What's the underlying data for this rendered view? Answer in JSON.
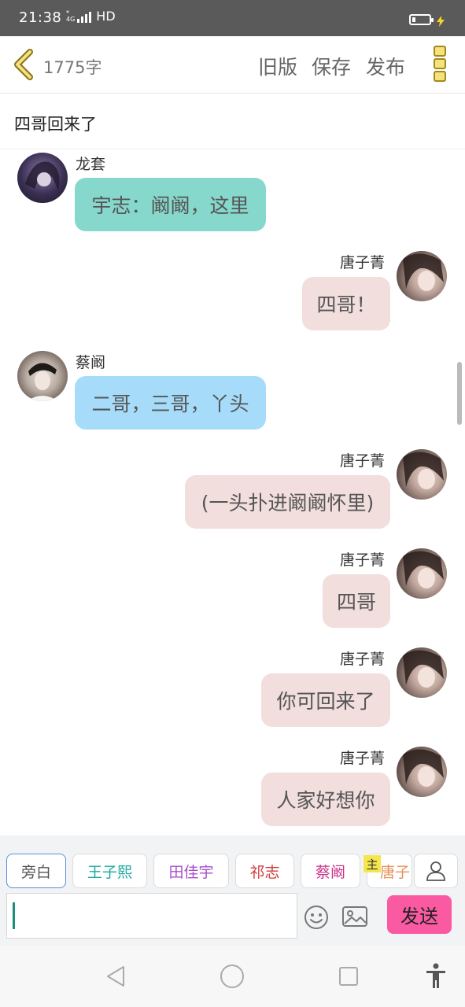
{
  "status": {
    "time": "21:38",
    "net_top": "*",
    "net_bottom": "4G",
    "hd": "HD"
  },
  "toolbar": {
    "word_count": "1775字",
    "old_version": "旧版",
    "save": "保存",
    "publish": "发布"
  },
  "title": "四哥回来了",
  "messages": [
    {
      "speaker": "龙套",
      "text": "宇志：阚阚，这里",
      "side": "left",
      "color": "#86d8cc"
    },
    {
      "speaker": "唐子菁",
      "text": "四哥！",
      "side": "right",
      "color": "#f1dedd"
    },
    {
      "speaker": "蔡阚",
      "text": "二哥，三哥，丫头",
      "side": "left",
      "color": "#a6dcfa"
    },
    {
      "speaker": "唐子菁",
      "text": "(一头扑进阚阚怀里)",
      "side": "right",
      "color": "#f1dedd"
    },
    {
      "speaker": "唐子菁",
      "text": "四哥",
      "side": "right",
      "color": "#f1dedd"
    },
    {
      "speaker": "唐子菁",
      "text": "你可回来了",
      "side": "right",
      "color": "#f1dedd"
    },
    {
      "speaker": "唐子菁",
      "text": "人家好想你",
      "side": "right",
      "color": "#f1dedd"
    }
  ],
  "roles": [
    {
      "name": "旁白",
      "color": "#555555"
    },
    {
      "name": "王子熙",
      "color": "#1aa8a0"
    },
    {
      "name": "田佳宇",
      "color": "#a84fc8"
    },
    {
      "name": "祁志",
      "color": "#d23b3b"
    },
    {
      "name": "蔡阚",
      "color": "#c8378a"
    },
    {
      "name": "唐子",
      "color": "#e6915a"
    }
  ],
  "main_badge": "主",
  "send": "发送"
}
